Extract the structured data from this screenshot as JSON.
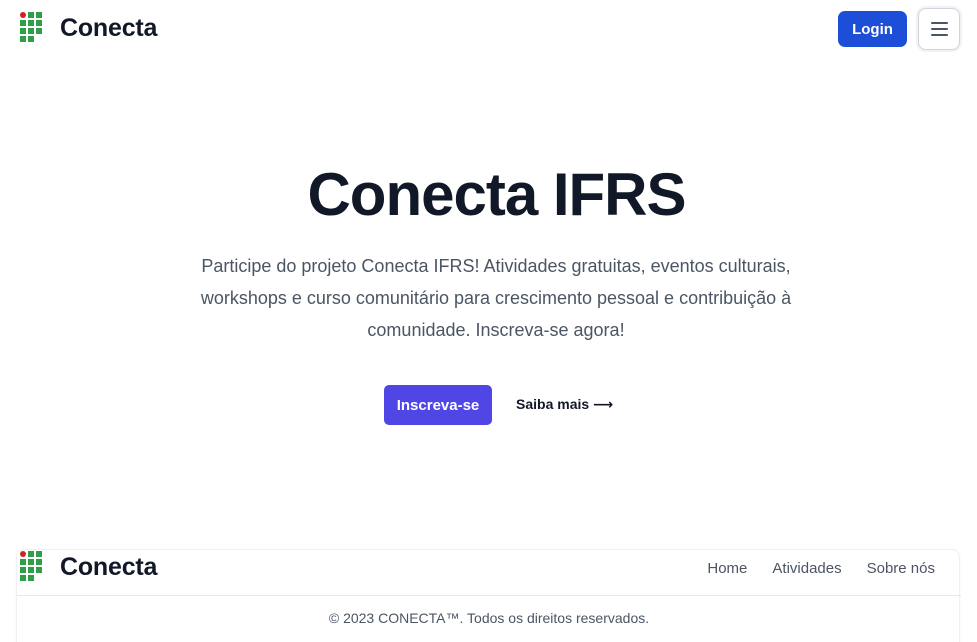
{
  "header": {
    "brand_name": "Conecta",
    "logo_icon": "ifrs-logo-icon",
    "login_label": "Login",
    "menu_icon": "hamburger-menu-icon"
  },
  "hero": {
    "title": "Conecta IFRS",
    "description": "Participe do projeto Conecta IFRS! Atividades gratuitas, eventos culturais, workshops e curso comunitário para crescimento pessoal e contribuição à comunidade. Inscreva-se agora!",
    "primary_cta_label": "Inscreva-se",
    "secondary_cta_label": "Saiba mais ⟶"
  },
  "footer": {
    "brand_name": "Conecta",
    "links": [
      "Home",
      "Atividades",
      "Sobre nós"
    ],
    "copyright": "© 2023 CONECTA™. Todos os direitos reservados."
  },
  "colors": {
    "primary_blue": "#1d4ed8",
    "primary_indigo": "#4f46e5",
    "logo_green": "#2e9e47",
    "logo_red": "#d0231f",
    "text_dark": "#111827",
    "text_muted": "#4b5563"
  }
}
